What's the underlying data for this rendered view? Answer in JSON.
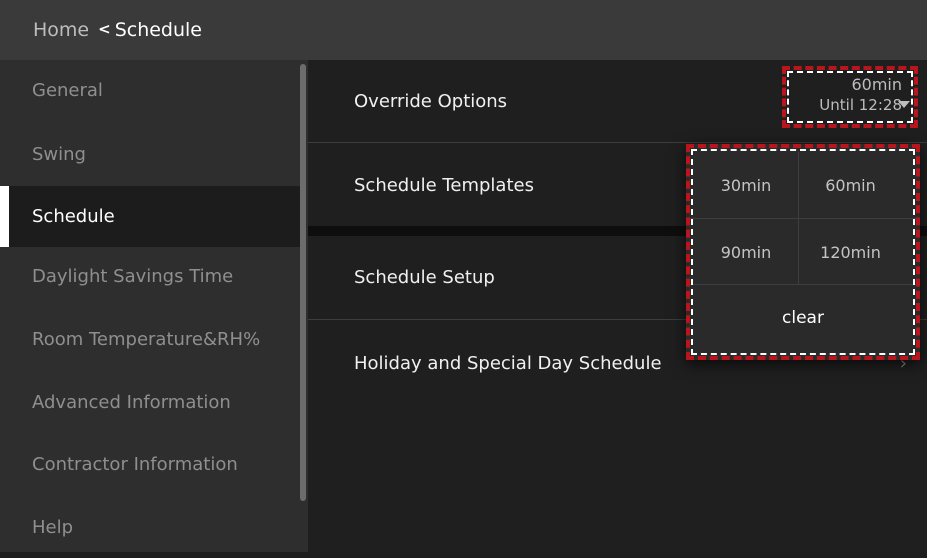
{
  "header": {
    "home_label": "Home",
    "back_glyph": "<",
    "title": "Schedule"
  },
  "sidebar": {
    "items": [
      {
        "label": "General",
        "active": false
      },
      {
        "label": "Swing",
        "active": false
      },
      {
        "label": "Schedule",
        "active": true
      },
      {
        "label": "Daylight Savings Time",
        "active": false
      },
      {
        "label": "Room Temperature&RH%",
        "active": false
      },
      {
        "label": "Advanced Information",
        "active": false
      },
      {
        "label": "Contractor Information",
        "active": false
      },
      {
        "label": "Help",
        "active": false
      }
    ]
  },
  "main": {
    "rows": [
      {
        "label": "Override Options"
      },
      {
        "label": "Schedule Templates"
      },
      {
        "label": "Schedule Setup"
      },
      {
        "label": "Holiday and Special Day Schedule"
      }
    ],
    "override_value": {
      "duration": "60min",
      "until": "Until 12:28"
    }
  },
  "popup": {
    "options": [
      "30min",
      "60min",
      "90min",
      "120min"
    ],
    "clear_label": "clear"
  },
  "colors": {
    "highlight_red": "#b8161c",
    "topbar": "#3a3a3a",
    "sidebar": "#2e2e2e",
    "active_accent": "#ffffff"
  }
}
